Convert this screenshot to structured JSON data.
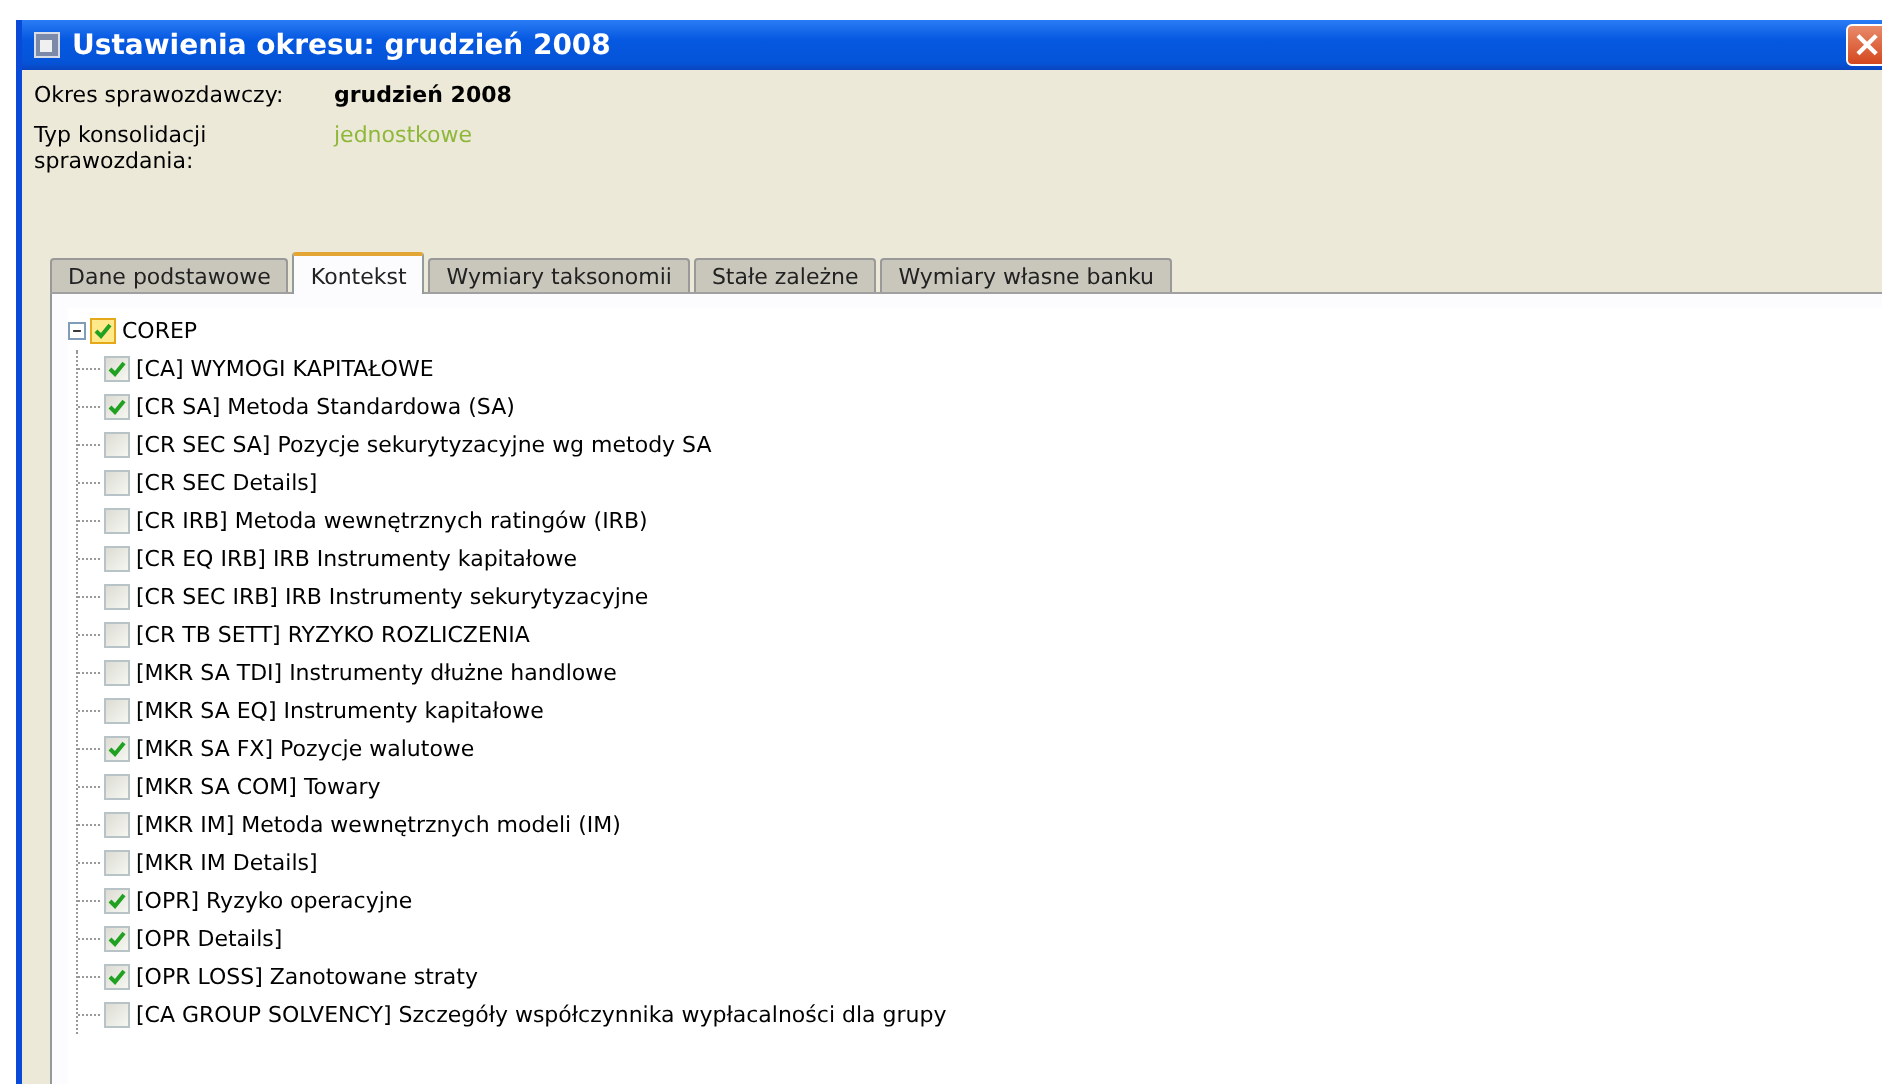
{
  "window": {
    "title": "Ustawienia okresu: grudzień 2008",
    "close": "×"
  },
  "fields": [
    {
      "label": "Okres sprawozdawczy:",
      "value": "grudzień 2008",
      "kind": "bold"
    },
    {
      "label": "Typ konsolidacji sprawozdania:",
      "value": "jednostkowe",
      "kind": "green"
    }
  ],
  "tabs": [
    {
      "label": "Dane podstawowe",
      "selected": false
    },
    {
      "label": "Kontekst",
      "selected": true
    },
    {
      "label": "Wymiary taksonomii",
      "selected": false
    },
    {
      "label": "Stałe zależne",
      "selected": false
    },
    {
      "label": "Wymiary własne banku",
      "selected": false
    }
  ],
  "tree": [
    {
      "label": "COREP",
      "checked": true,
      "expanded": true,
      "children": [
        {
          "label": "[CA] WYMOGI KAPITAŁOWE",
          "checked": true
        },
        {
          "label": "[CR SA] Metoda Standardowa (SA)",
          "checked": true
        },
        {
          "label": "[CR SEC SA] Pozycje sekurytyzacyjne wg metody SA",
          "checked": false
        },
        {
          "label": "[CR SEC Details]",
          "checked": false
        },
        {
          "label": "[CR IRB] Metoda wewnętrznych ratingów (IRB)",
          "checked": false
        },
        {
          "label": "[CR EQ IRB] IRB Instrumenty kapitałowe",
          "checked": false
        },
        {
          "label": "[CR SEC IRB] IRB Instrumenty sekurytyzacyjne",
          "checked": false
        },
        {
          "label": "[CR TB SETT] RYZYKO ROZLICZENIA",
          "checked": false
        },
        {
          "label": "[MKR SA TDI] Instrumenty dłużne handlowe",
          "checked": false
        },
        {
          "label": "[MKR SA EQ] Instrumenty kapitałowe",
          "checked": false
        },
        {
          "label": "[MKR SA FX] Pozycje walutowe",
          "checked": true
        },
        {
          "label": "[MKR SA COM] Towary",
          "checked": false
        },
        {
          "label": "[MKR IM] Metoda wewnętrznych modeli (IM)",
          "checked": false
        },
        {
          "label": "[MKR IM Details]",
          "checked": false
        },
        {
          "label": "[OPR] Ryzyko operacyjne",
          "checked": true
        },
        {
          "label": "[OPR Details]",
          "checked": true
        },
        {
          "label": "[OPR LOSS] Zanotowane straty",
          "checked": true
        },
        {
          "label": "[CA GROUP SOLVENCY] Szczegóły współczynnika wypłacalności dla grupy",
          "checked": false
        }
      ]
    }
  ]
}
